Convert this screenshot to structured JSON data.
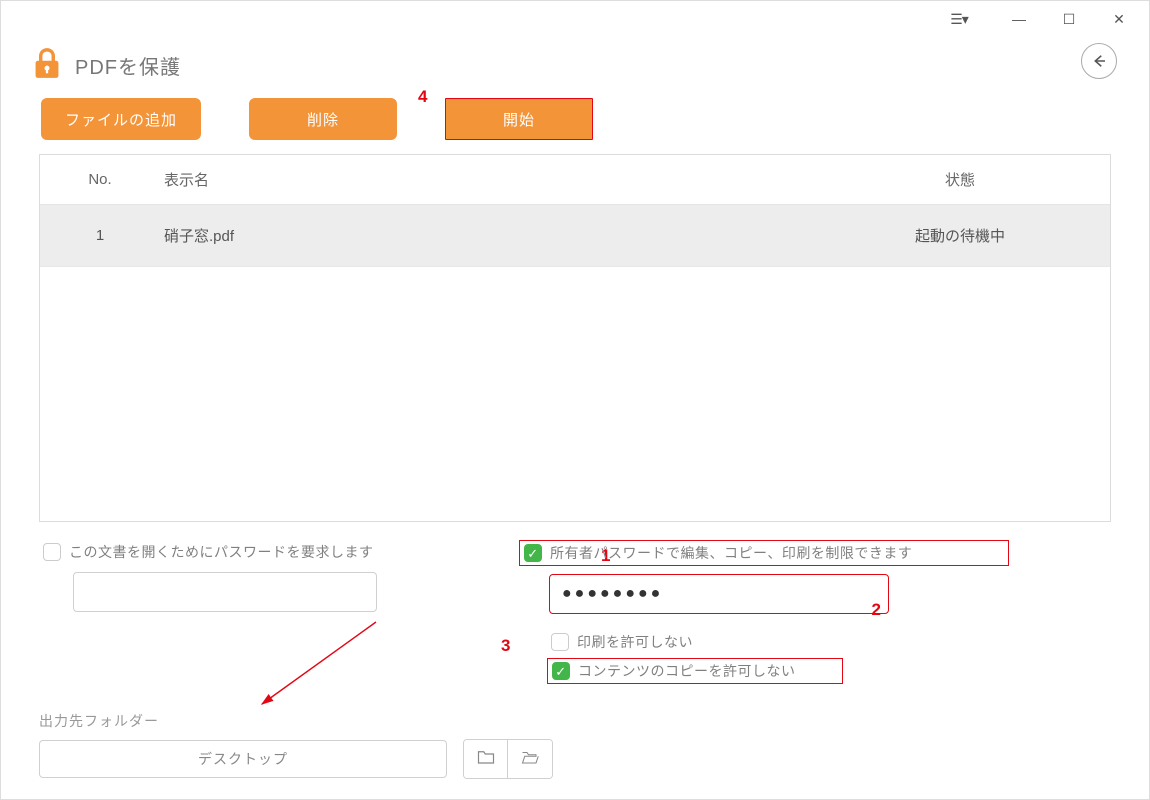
{
  "title": "PDFを保護",
  "toolbar": {
    "add_file": "ファイルの追加",
    "delete": "削除",
    "start": "開始"
  },
  "table": {
    "headers": {
      "no": "No.",
      "name": "表示名",
      "status": "状態"
    },
    "rows": [
      {
        "no": "1",
        "name": "硝子窓.pdf",
        "status": "起動の待機中"
      }
    ]
  },
  "options": {
    "open_password_label": "この文書を開くためにパスワードを要求します",
    "open_password_checked": false,
    "open_password_value": "",
    "owner_password_label": "所有者パスワードで編集、コピー、印刷を制限できます",
    "owner_password_checked": true,
    "owner_password_value": "●●●●●●●●",
    "disallow_print_label": "印刷を許可しない",
    "disallow_print_checked": false,
    "disallow_copy_label": "コンテンツのコピーを許可しない",
    "disallow_copy_checked": true
  },
  "output": {
    "label": "出力先フォルダー",
    "folder": "デスクトップ"
  },
  "annotations": {
    "n1": "1",
    "n2": "2",
    "n3": "3",
    "n4": "4"
  }
}
